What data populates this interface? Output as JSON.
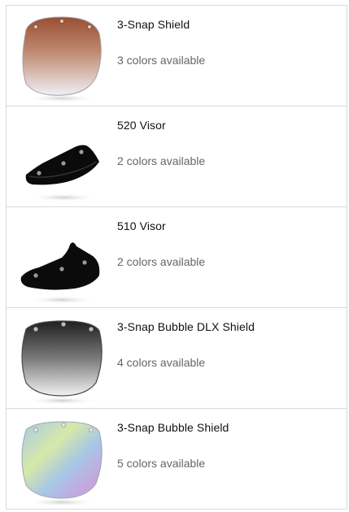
{
  "products": [
    {
      "name": "3-Snap Shield",
      "colors": "3 colors available",
      "icon": "three-snap-shield-icon",
      "tint": "#b0684c"
    },
    {
      "name": "520 Visor",
      "colors": "2 colors available",
      "icon": "visor-520-icon",
      "tint": "#111111"
    },
    {
      "name": "510 Visor",
      "colors": "2 colors available",
      "icon": "visor-510-icon",
      "tint": "#111111"
    },
    {
      "name": "3-Snap Bubble DLX Shield",
      "colors": "4 colors available",
      "icon": "bubble-dlx-shield-icon",
      "tint": "#3a3a3a"
    },
    {
      "name": "3-Snap Bubble Shield",
      "colors": "5 colors available",
      "icon": "bubble-shield-icon",
      "tint": "#8fb8d8"
    }
  ]
}
